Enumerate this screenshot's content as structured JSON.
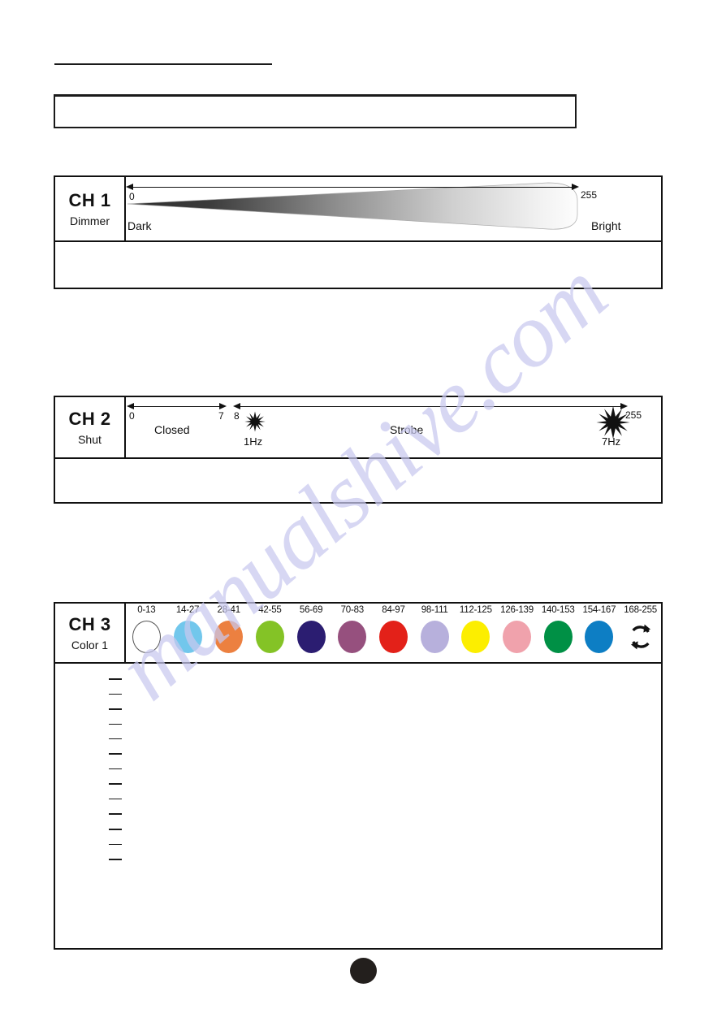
{
  "document": {
    "watermark_text": "manualshive.com",
    "page_marker": "",
    "title_box_text": ""
  },
  "channels": [
    {
      "id": "ch1",
      "name": "CH 1",
      "function": "Dimmer",
      "axis": {
        "start_label": "0",
        "end_label": "255",
        "low_text": "Dark",
        "high_text": "Bright"
      }
    },
    {
      "id": "ch2",
      "name": "CH 2",
      "function": "Shut",
      "segments": [
        {
          "zone": "Closed",
          "start_label": "0",
          "end_label": "7"
        },
        {
          "zone": "Strobe",
          "start_label": "8",
          "end_label": "255",
          "rate_low": "1Hz",
          "rate_high": "7Hz"
        }
      ]
    },
    {
      "id": "ch3",
      "name": "CH 3",
      "function": "Color 1",
      "swatches": [
        {
          "range": "0-13",
          "color": "#ffffff",
          "icon": "color-swatch",
          "outlined": true
        },
        {
          "range": "14-27",
          "color": "#72c7ec",
          "icon": "color-swatch",
          "outlined": false
        },
        {
          "range": "28-41",
          "color": "#ec8040",
          "icon": "color-swatch",
          "outlined": false
        },
        {
          "range": "42-55",
          "color": "#84c326",
          "icon": "color-swatch",
          "outlined": false
        },
        {
          "range": "56-69",
          "color": "#2b1d71",
          "icon": "color-swatch",
          "outlined": false
        },
        {
          "range": "70-83",
          "color": "#96507e",
          "icon": "color-swatch",
          "outlined": false
        },
        {
          "range": "84-97",
          "color": "#e32119",
          "icon": "color-swatch",
          "outlined": false
        },
        {
          "range": "98-111",
          "color": "#b7b0dc",
          "icon": "color-swatch",
          "outlined": false
        },
        {
          "range": "112-125",
          "color": "#fcee00",
          "icon": "color-swatch",
          "outlined": false
        },
        {
          "range": "126-139",
          "color": "#f0a2ac",
          "icon": "color-swatch",
          "outlined": false
        },
        {
          "range": "140-153",
          "color": "#009045",
          "icon": "color-swatch",
          "outlined": false
        },
        {
          "range": "154-167",
          "color": "#0d7ec4",
          "icon": "color-swatch",
          "outlined": false
        },
        {
          "range": "168-255",
          "color": "#111111",
          "icon": "rotate-icon",
          "outlined": false
        }
      ],
      "note_dashes": [
        "thick",
        "thin",
        "thick",
        "thin",
        "thin",
        "thick",
        "thin",
        "thick",
        "thin",
        "thick",
        "thick",
        "thin",
        "thick"
      ]
    }
  ]
}
